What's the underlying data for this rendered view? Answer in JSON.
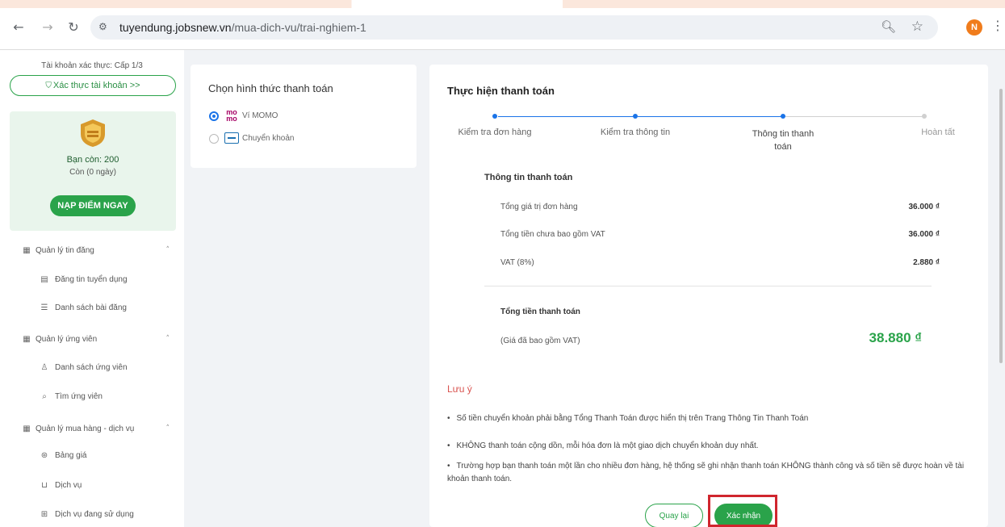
{
  "browser": {
    "url_host": "tuyendung.jobsnew.vn",
    "url_path": "/mua-dich-vu/trai-nghiem-1",
    "profile_initial": "N"
  },
  "sidebar": {
    "account_level": "Tài khoản xác thực: Cấp 1/3",
    "verify_button": "Xác thực tài khoản >>",
    "points": "Bạn còn: 200",
    "days": "Còn (0 ngày)",
    "topup_button": "NẠP ĐIỂM NGAY",
    "menu": [
      {
        "type": "group",
        "icon": "grid-icon",
        "label": "Quản lý tin đăng"
      },
      {
        "type": "child",
        "icon": "post-icon",
        "label": "Đăng tin tuyển dụng"
      },
      {
        "type": "child",
        "icon": "list-icon",
        "label": "Danh sách bài đăng"
      },
      {
        "type": "group",
        "icon": "grid-icon",
        "label": "Quản lý ứng viên"
      },
      {
        "type": "child",
        "icon": "user-icon",
        "label": "Danh sách ứng viên"
      },
      {
        "type": "child",
        "icon": "search-icon",
        "label": "Tìm ứng viên"
      },
      {
        "type": "group",
        "icon": "grid-icon",
        "label": "Quản lý mua hàng - dịch vụ"
      },
      {
        "type": "child",
        "icon": "price-icon",
        "label": "Bảng giá"
      },
      {
        "type": "child",
        "icon": "cart-icon",
        "label": "Dịch vụ"
      },
      {
        "type": "child",
        "icon": "service-icon",
        "label": "Dịch vụ đang sử dụng"
      }
    ]
  },
  "payment_method": {
    "title": "Chọn hình thức thanh toán",
    "options": [
      {
        "label": "Ví MOMO",
        "selected": true
      },
      {
        "label": "Chuyển khoản",
        "selected": false
      }
    ],
    "momo_logo": "mo mo"
  },
  "payment": {
    "title": "Thực hiện thanh toán",
    "steps": [
      "Kiểm tra đơn hàng",
      "Kiểm tra thông tin",
      "Thông tin thanh toán",
      "Hoàn tất"
    ],
    "active_step": 3,
    "info_title": "Thông tin thanh toán",
    "rows": [
      {
        "label": "Tổng giá trị đơn hàng",
        "value": "36.000 ₫"
      },
      {
        "label": "Tổng tiền chưa bao gồm VAT",
        "value": "36.000 ₫"
      },
      {
        "label": "VAT (8%)",
        "value": "2.880 ₫"
      }
    ],
    "total_label": "Tổng tiền thanh toán",
    "total_note": "(Giá đã bao gồm VAT)",
    "total_value": "38.880 ₫",
    "note_title": "Lưu ý",
    "notes": [
      "Số tiền chuyển khoản phải bằng Tổng Thanh Toán được hiển thị trên Trang Thông Tin Thanh Toán",
      "KHÔNG thanh toán cộng dồn, mỗi hóa đơn là một giao dịch chuyển khoản duy nhất.",
      "Trường hợp bạn thanh toán một lần cho nhiều đơn hàng, hệ thống sẽ ghi nhận thanh toán KHÔNG thành công và số tiền sẽ được hoàn về tài khoản thanh toán."
    ],
    "back_button": "Quay lại",
    "confirm_button": "Xác nhận"
  },
  "colors": {
    "brand_green": "#2aa34a",
    "highlight_red": "#d0262e",
    "step_blue": "#1a73e8"
  }
}
